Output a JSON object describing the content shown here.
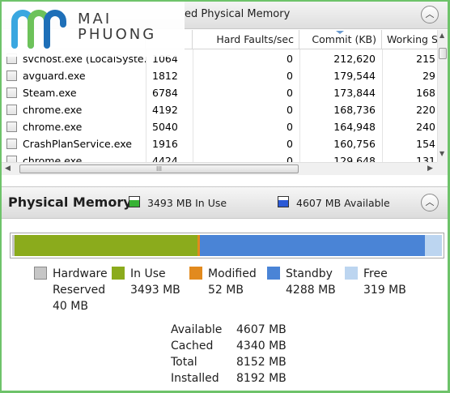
{
  "top_pane": {
    "header_title": "ed Physical Memory",
    "columns": [
      "Hard Faults/sec",
      "Commit (KB)",
      "Working S"
    ],
    "processes": [
      {
        "name": "svchost.exe (LocalSyste...",
        "pid": "1064",
        "hard_faults": "0",
        "commit": "212,620",
        "working": "215"
      },
      {
        "name": "avguard.exe",
        "pid": "1812",
        "hard_faults": "0",
        "commit": "179,544",
        "working": "29"
      },
      {
        "name": "Steam.exe",
        "pid": "6784",
        "hard_faults": "0",
        "commit": "173,844",
        "working": "168"
      },
      {
        "name": "chrome.exe",
        "pid": "4192",
        "hard_faults": "0",
        "commit": "168,736",
        "working": "220"
      },
      {
        "name": "chrome.exe",
        "pid": "5040",
        "hard_faults": "0",
        "commit": "164,948",
        "working": "240"
      },
      {
        "name": "CrashPlanService.exe",
        "pid": "1916",
        "hard_faults": "0",
        "commit": "160,756",
        "working": "154"
      },
      {
        "name": "chrome.exe",
        "pid": "4424",
        "hard_faults": "0",
        "commit": "129,648",
        "working": "131"
      }
    ],
    "collapse_icon": "chevron-up-icon",
    "hscroll_grip": "III"
  },
  "physical_memory": {
    "title": "Physical Memory",
    "in_use_summary": "3493 MB In Use",
    "available_summary": "4607 MB Available",
    "collapse_icon": "chevron-up-icon",
    "bar_segments_mb": {
      "hardware_reserved": 40,
      "in_use": 3493,
      "modified": 52,
      "standby": 4288,
      "free": 319
    },
    "legend": [
      {
        "label": "Hardware",
        "label2": "Reserved",
        "value": "40 MB",
        "color": "#c6c6c6"
      },
      {
        "label": "In Use",
        "value": "3493 MB",
        "color": "#8bab1c"
      },
      {
        "label": "Modified",
        "value": "52 MB",
        "color": "#e28a1e"
      },
      {
        "label": "Standby",
        "value": "4288 MB",
        "color": "#4a84d6"
      },
      {
        "label": "Free",
        "value": "319 MB",
        "color": "#bcd5f0"
      }
    ],
    "stats": [
      {
        "label": "Available",
        "value": "4607 MB"
      },
      {
        "label": "Cached",
        "value": "4340 MB"
      },
      {
        "label": "Total",
        "value": "8152 MB"
      },
      {
        "label": "Installed",
        "value": "8192 MB"
      }
    ]
  },
  "watermark": {
    "line1": "MAI",
    "line2": "PHUONG",
    "colors": [
      "#3aa7e0",
      "#6dc25a",
      "#1e6fb8"
    ]
  }
}
